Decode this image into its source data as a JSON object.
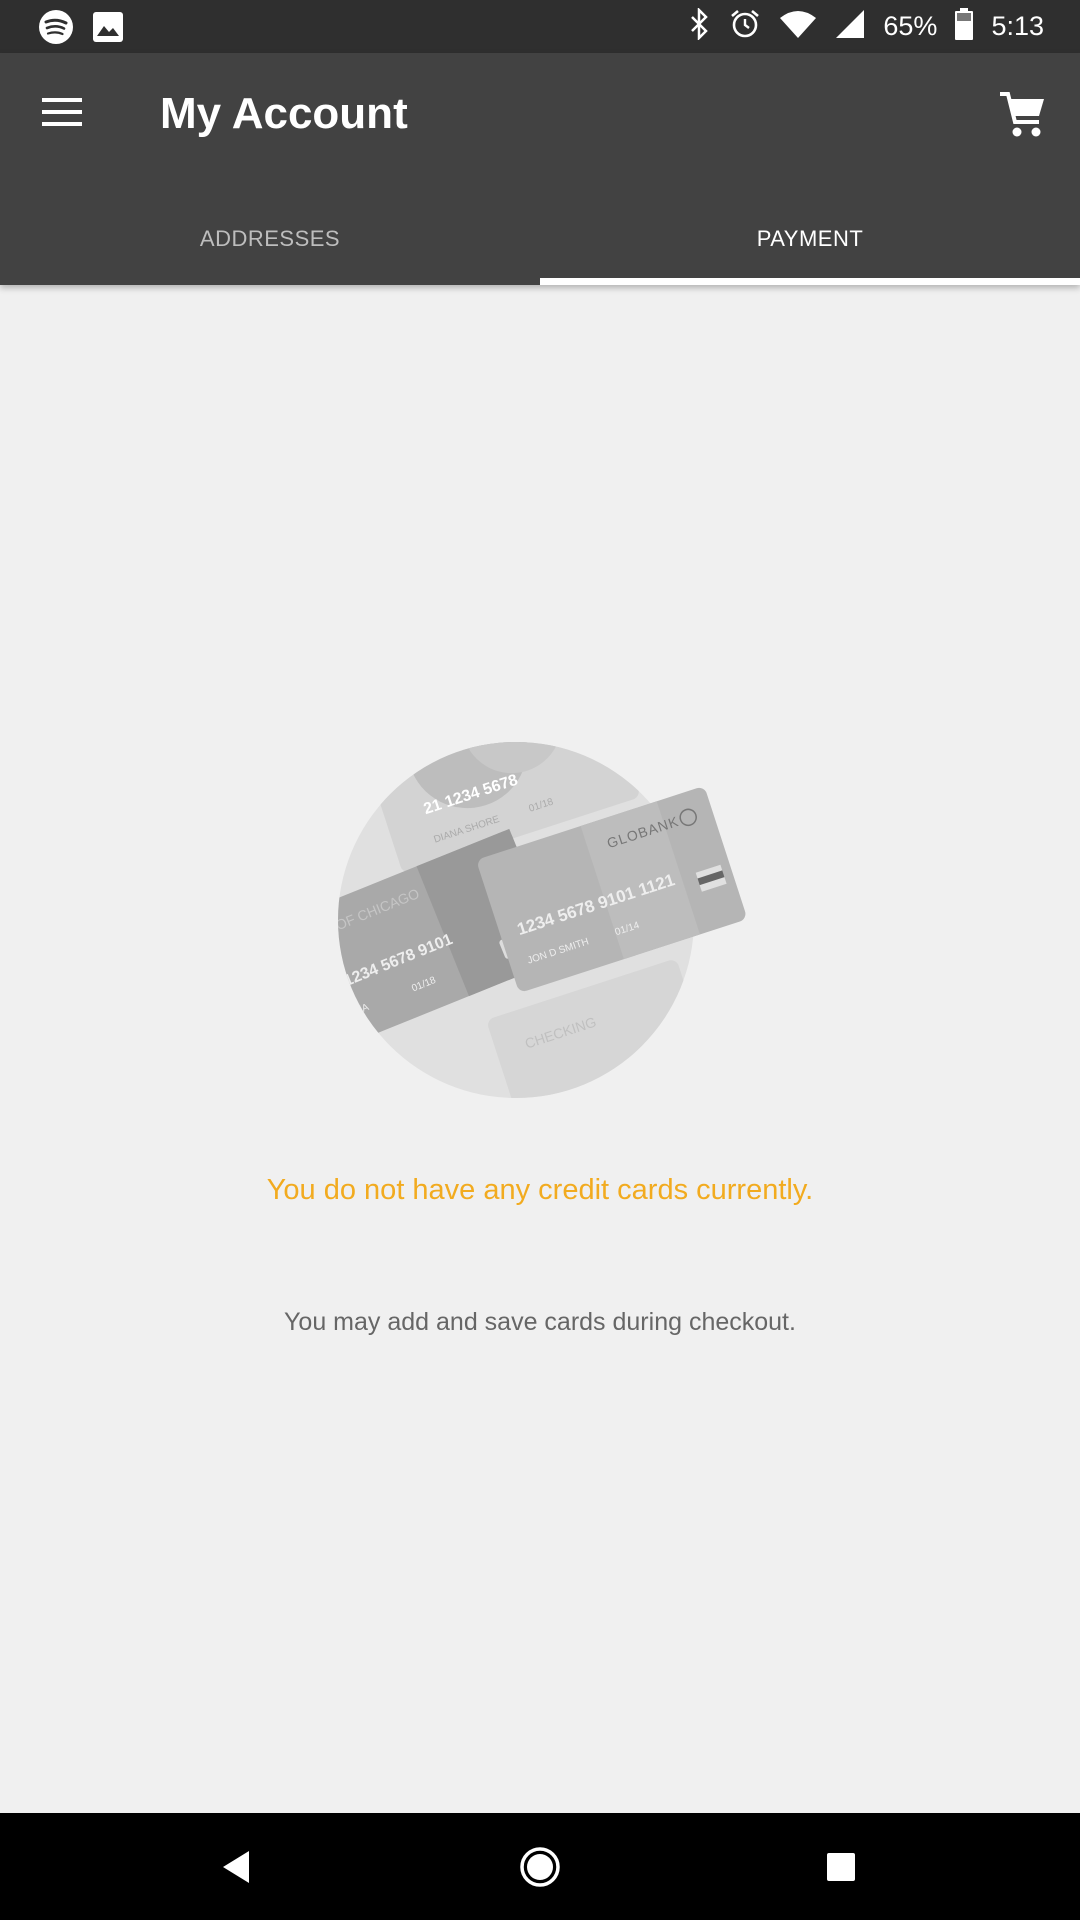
{
  "status_bar": {
    "battery_text": "65%",
    "time": "5:13",
    "left_icons": [
      "spotify-icon",
      "image-icon"
    ],
    "right_icons": [
      "bluetooth-icon",
      "alarm-icon",
      "wifi-icon",
      "cell-signal-icon",
      "battery-icon"
    ]
  },
  "app_bar": {
    "title": "My Account",
    "menu_icon": "hamburger-menu-icon",
    "cart_icon": "shopping-cart-icon"
  },
  "tabs": [
    {
      "label": "ADDRESSES",
      "active": false
    },
    {
      "label": "PAYMENT",
      "active": true
    }
  ],
  "empty_state": {
    "title": "You do not have any credit cards currently.",
    "subtitle": "You may add and save cards during checkout.",
    "illustration": {
      "card_top": {
        "number": "21 1234 5678",
        "name": "DIANA SHORE",
        "exp": "01/18"
      },
      "card_left": {
        "bank": "NK OF CHICAGO",
        "number": "1234 5678 9101",
        "name": "ZA",
        "exp": "01/18"
      },
      "card_main": {
        "bank": "GLOBANK",
        "number": "1234 5678 9101 1121",
        "name": "JON D SMITH",
        "exp": "01/14"
      },
      "card_bottom": {
        "label": "CHECKING"
      }
    }
  },
  "colors": {
    "accent": "#f2ab1f",
    "app_bar": "#424242",
    "status_bar": "#2f2f2f",
    "background": "#f0f0f0"
  },
  "nav_bar": {
    "icons": [
      "back-icon",
      "home-icon",
      "recents-icon"
    ]
  }
}
